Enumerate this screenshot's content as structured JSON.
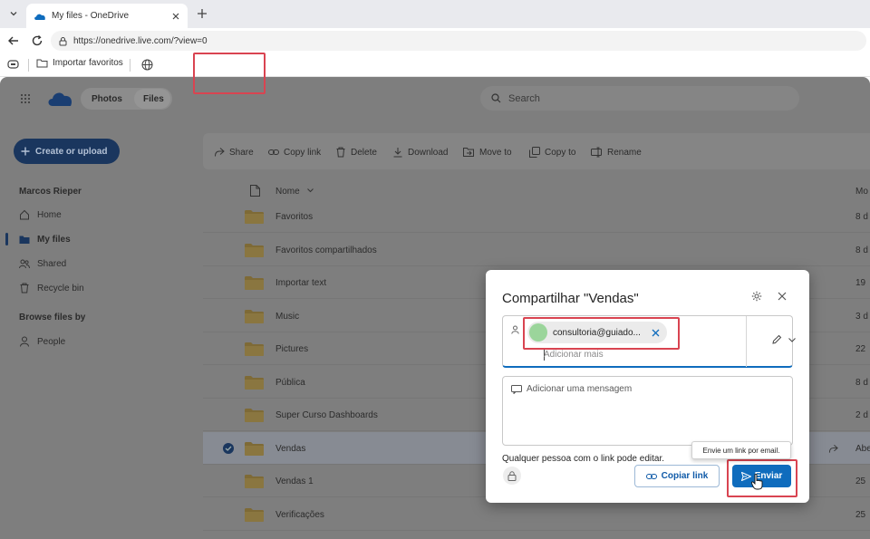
{
  "browser": {
    "tab_title": "My files - OneDrive",
    "url": "https://onedrive.live.com/?view=0",
    "favorites_item": "Importar favoritos"
  },
  "app": {
    "nav_pills": [
      "Photos",
      "Files"
    ],
    "search_placeholder": "Search",
    "create_button": "Create or upload",
    "user_name": "Marcos Rieper",
    "sidebar": [
      {
        "label": "Home",
        "icon": "home-icon"
      },
      {
        "label": "My files",
        "icon": "folder-icon"
      },
      {
        "label": "Shared",
        "icon": "people-icon"
      },
      {
        "label": "Recycle bin",
        "icon": "trash-icon"
      }
    ],
    "browse_heading": "Browse files by",
    "browse_items": [
      {
        "label": "People",
        "icon": "person-icon"
      }
    ],
    "toolbar": [
      "Share",
      "Copy link",
      "Delete",
      "Download",
      "Move to",
      "Copy to",
      "Rename"
    ],
    "columns": {
      "name": "Nome",
      "modified": "Mo"
    },
    "files": [
      {
        "name": "Favoritos",
        "modified": "8 d"
      },
      {
        "name": "Favoritos compartilhados",
        "modified": "8 d"
      },
      {
        "name": "Importar text",
        "modified": "19"
      },
      {
        "name": "Music",
        "modified": "3 d"
      },
      {
        "name": "Pictures",
        "modified": "22"
      },
      {
        "name": "Pública",
        "modified": "8 d"
      },
      {
        "name": "Super Curso Dashboards",
        "modified": "2 d"
      },
      {
        "name": "Vendas",
        "modified": "Abe",
        "selected": true
      },
      {
        "name": "Vendas 1",
        "modified": "25"
      },
      {
        "name": "Verificações",
        "modified": "25"
      }
    ]
  },
  "dialog": {
    "title": "Compartilhar \"Vendas\"",
    "recipient": "consultoria@guiado...",
    "add_more_placeholder": "Adicionar mais",
    "message_placeholder": "Adicionar uma mensagem",
    "link_setting": "Qualquer pessoa com o link pode editar.",
    "copy_link_button": "Copiar link",
    "send_button": "Enviar",
    "send_tooltip": "Envie um link por email."
  },
  "colors": {
    "accent": "#0f6cbd",
    "highlight": "#d94451",
    "dim_overlay": "#7e7e7e"
  }
}
